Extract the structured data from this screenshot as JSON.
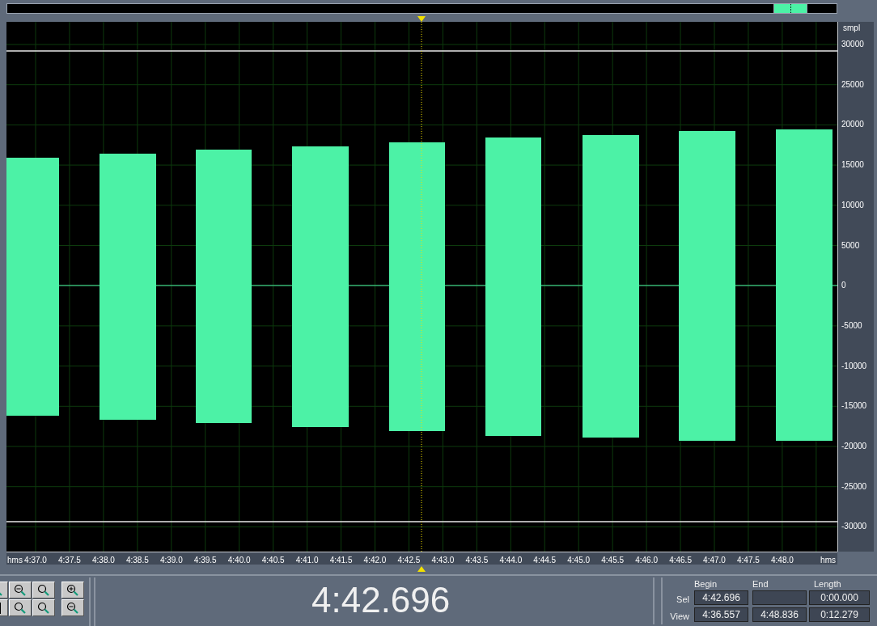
{
  "waveform": {
    "y_unit": "smpl",
    "y_ticks": [
      "30000",
      "25000",
      "20000",
      "15000",
      "10000",
      "5000",
      "0",
      "-5000",
      "-10000",
      "-15000",
      "-20000",
      "-25000",
      "-30000"
    ]
  },
  "time_ruler": {
    "unit_left": "hms",
    "unit_right": "hms",
    "labels": [
      "4:37.0",
      "4:37.5",
      "4:38.0",
      "4:38.5",
      "4:39.0",
      "4:39.5",
      "4:40.0",
      "4:40.5",
      "4:41.0",
      "4:41.5",
      "4:42.0",
      "4:42.5",
      "4:43.0",
      "4:43.5",
      "4:44.0",
      "4:44.5",
      "4:45.0",
      "4:45.5",
      "4:46.0",
      "4:46.5",
      "4:47.0",
      "4:47.5",
      "4:48.0"
    ]
  },
  "time_display": "4:42.696",
  "selection_panel": {
    "columns": [
      "Begin",
      "End",
      "Length"
    ],
    "rows": [
      {
        "label": "Sel",
        "begin": "4:42.696",
        "length": "0:00.000"
      },
      {
        "label": "View",
        "begin": "4:36.557",
        "end": "4:48.836",
        "length": "0:12.279"
      }
    ]
  }
}
